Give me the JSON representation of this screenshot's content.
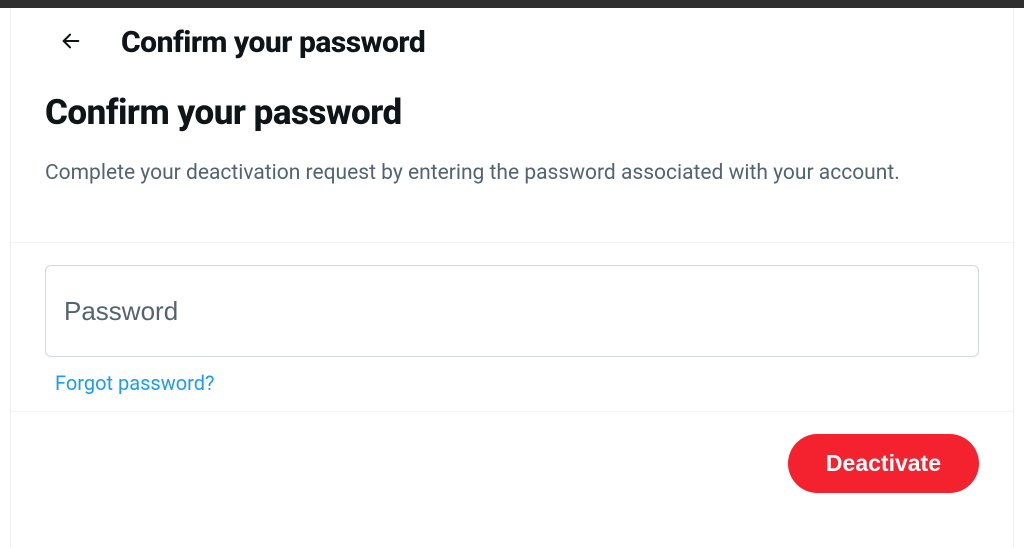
{
  "header": {
    "title": "Confirm your password"
  },
  "main": {
    "page_title": "Confirm your password",
    "description": "Complete your deactivation request by entering the password associated with your account."
  },
  "form": {
    "password_placeholder": "Password",
    "password_value": "",
    "forgot_link": "Forgot password?"
  },
  "footer": {
    "deactivate_label": "Deactivate"
  }
}
